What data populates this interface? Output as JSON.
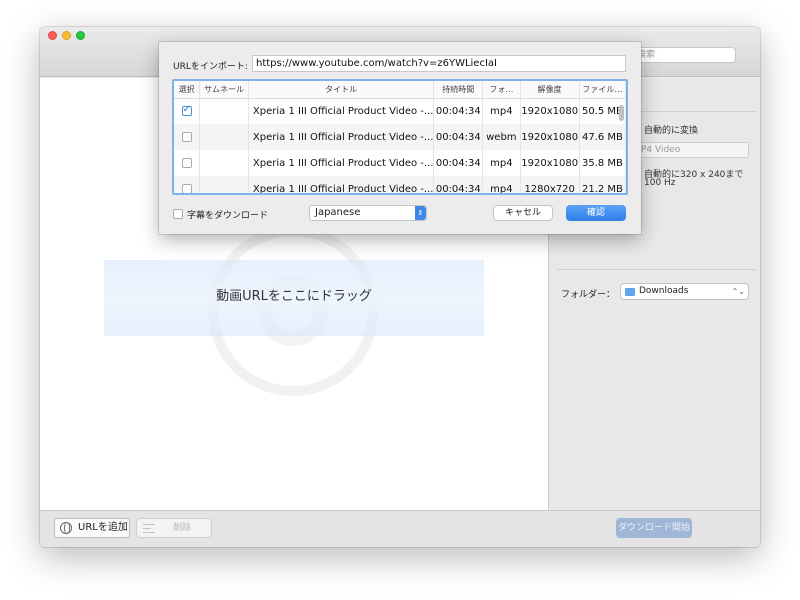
{
  "toolbar": {
    "search_placeholder": "検索"
  },
  "main": {
    "drop_hint": "動画URLをここにドラッグ"
  },
  "right_panel": {
    "auto_convert": "自動的に変換",
    "format_placeholder": "P4 Video",
    "note_line1": "自動的に320 x 240まで",
    "note_line2": "100 Hz",
    "folder_label": "フォルダー：",
    "folder_value": "Downloads"
  },
  "bottom": {
    "add_url": "URLを追加",
    "delete": "削除",
    "start_download": "ダウンロード開始"
  },
  "import_sheet": {
    "url_label": "URLをインポート:",
    "url_value": "https://www.youtube.com/watch?v=z6YWLiecIaI",
    "columns": {
      "select": "選択",
      "thumbnail": "サムネール",
      "title": "タイトル",
      "duration": "持続時間",
      "format": "フォ…",
      "resolution": "解像度",
      "filesize": "ファイル…"
    },
    "rows": [
      {
        "checked": true,
        "title": "Xperia 1 III Official Product Video -...",
        "duration": "00:04:34",
        "format": "mp4",
        "resolution": "1920x1080",
        "size": "50.5 MB"
      },
      {
        "checked": false,
        "title": "Xperia 1 III Official Product Video -...",
        "duration": "00:04:34",
        "format": "webm",
        "resolution": "1920x1080",
        "size": "47.6 MB"
      },
      {
        "checked": false,
        "title": "Xperia 1 III Official Product Video -...",
        "duration": "00:04:34",
        "format": "mp4",
        "resolution": "1920x1080",
        "size": "35.8 MB"
      },
      {
        "checked": false,
        "title": "Xperia 1 III Official Product Video -...",
        "duration": "00:04:34",
        "format": "mp4",
        "resolution": "1280x720",
        "size": "21.2 MB"
      }
    ],
    "subtitle_label": "字幕をダウンロード",
    "language": "Japanese",
    "cancel": "キャセル",
    "confirm": "確認"
  }
}
